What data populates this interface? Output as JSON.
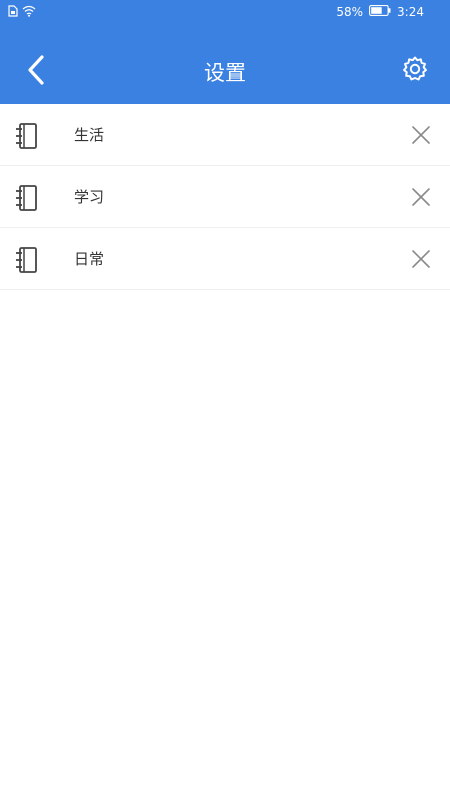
{
  "status_bar": {
    "battery_percent": "58%",
    "time": "3:24",
    "left_icons": [
      "sim-icon",
      "wifi-icon"
    ],
    "battery_icon": "battery-icon"
  },
  "header": {
    "title": "设置",
    "back_icon": "back-icon",
    "settings_icon": "gear-icon"
  },
  "list": {
    "items": [
      {
        "label": "生活",
        "icon": "notebook-icon",
        "action_icon": "close-icon"
      },
      {
        "label": "学习",
        "icon": "notebook-icon",
        "action_icon": "close-icon"
      },
      {
        "label": "日常",
        "icon": "notebook-icon",
        "action_icon": "close-icon"
      }
    ]
  },
  "colors": {
    "header_bg": "#3a81e1",
    "divider": "#efefef",
    "text": "#333333",
    "icon": "#444444"
  }
}
